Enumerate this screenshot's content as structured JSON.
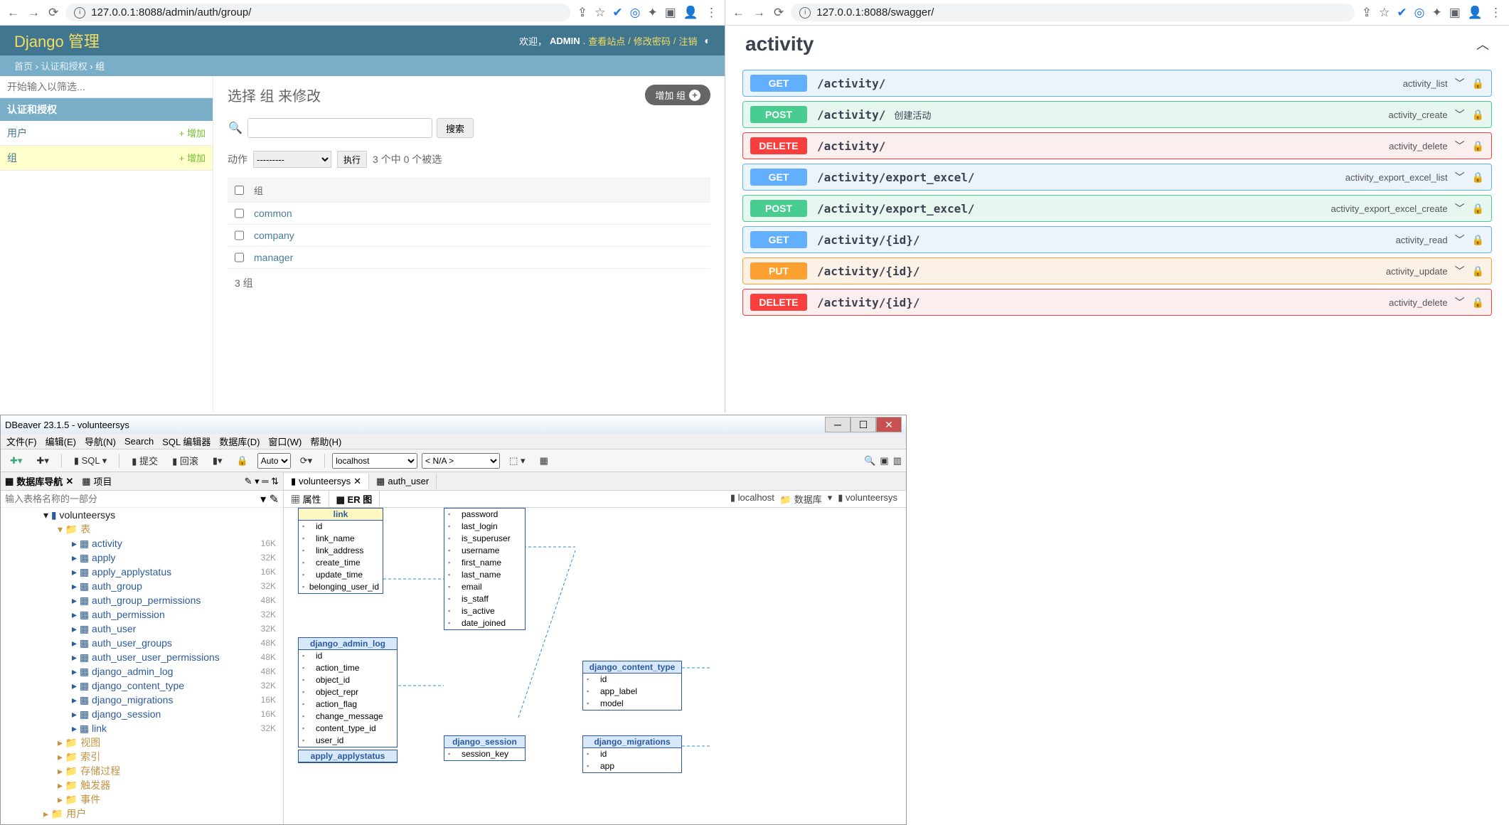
{
  "django": {
    "url": "127.0.0.1:8088/admin/auth/group/",
    "brand": "Django 管理",
    "welcome": "欢迎，",
    "user": "ADMIN",
    "view_site": "查看站点",
    "change_pw": "修改密码",
    "logout": "注销",
    "bc_home": "首页",
    "bc_app": "认证和授权",
    "bc_model": "组",
    "filter_ph": "开始输入以筛选...",
    "app_label": "认证和授权",
    "model_user": "用户",
    "model_group": "组",
    "add_link": "+ 增加",
    "h1": "选择 组 来修改",
    "add_btn": "增加 组",
    "search_btn": "搜索",
    "action_label": "动作",
    "action_default": "---------",
    "go": "执行",
    "sel_text": "3 个中 0 个被选",
    "th_group": "组",
    "rows": [
      "common",
      "company",
      "manager"
    ],
    "count": "3 组"
  },
  "swagger": {
    "url": "127.0.0.1:8088/swagger/",
    "tag": "activity",
    "ops": [
      {
        "verb": "GET",
        "path": "/activity/",
        "summary": "",
        "opid": "activity_list"
      },
      {
        "verb": "POST",
        "path": "/activity/",
        "summary": "创建活动",
        "opid": "activity_create"
      },
      {
        "verb": "DELETE",
        "path": "/activity/",
        "summary": "",
        "opid": "activity_delete"
      },
      {
        "verb": "GET",
        "path": "/activity/export_excel/",
        "summary": "",
        "opid": "activity_export_excel_list"
      },
      {
        "verb": "POST",
        "path": "/activity/export_excel/",
        "summary": "",
        "opid": "activity_export_excel_create"
      },
      {
        "verb": "GET",
        "path": "/activity/{id}/",
        "summary": "",
        "opid": "activity_read"
      },
      {
        "verb": "PUT",
        "path": "/activity/{id}/",
        "summary": "",
        "opid": "activity_update"
      },
      {
        "verb": "DELETE",
        "path": "/activity/{id}/",
        "summary": "",
        "opid": "activity_delete"
      }
    ]
  },
  "dbeaver": {
    "title": "DBeaver 23.1.5 - volunteersys",
    "menu": [
      "文件(F)",
      "编辑(E)",
      "导航(N)",
      "Search",
      "SQL 编辑器",
      "数据库(D)",
      "窗口(W)",
      "帮助(H)"
    ],
    "tool_sql": "SQL",
    "tool_commit": "提交",
    "tool_rollback": "回滚",
    "tool_auto": "Auto",
    "tool_conn": "localhost",
    "tool_db": "< N/A >",
    "nav_tab1": "数据库导航",
    "nav_tab2": "项目",
    "nav_filter_ph": "输入表格名称的一部分",
    "tree_root": "volunteersys",
    "tree_tables": "表",
    "tables": [
      {
        "n": "activity",
        "s": "16K"
      },
      {
        "n": "apply",
        "s": "32K"
      },
      {
        "n": "apply_applystatus",
        "s": "16K"
      },
      {
        "n": "auth_group",
        "s": "32K"
      },
      {
        "n": "auth_group_permissions",
        "s": "48K"
      },
      {
        "n": "auth_permission",
        "s": "32K"
      },
      {
        "n": "auth_user",
        "s": "32K"
      },
      {
        "n": "auth_user_groups",
        "s": "48K"
      },
      {
        "n": "auth_user_user_permissions",
        "s": "48K"
      },
      {
        "n": "django_admin_log",
        "s": "48K"
      },
      {
        "n": "django_content_type",
        "s": "32K"
      },
      {
        "n": "django_migrations",
        "s": "16K"
      },
      {
        "n": "django_session",
        "s": "16K"
      },
      {
        "n": "link",
        "s": "32K"
      }
    ],
    "tree_folders": [
      "视图",
      "索引",
      "存储过程",
      "触发器",
      "事件"
    ],
    "tree_users": "用户",
    "ed_tab1": "volunteersys",
    "ed_tab2": "auth_user",
    "sub_props": "属性",
    "sub_er": "ER 图",
    "crumb_host": "localhost",
    "crumb_db": "数据库",
    "crumb_schema": "volunteersys",
    "er": {
      "link": {
        "hd": "link",
        "cols": [
          "id",
          "link_name",
          "link_address",
          "create_time",
          "update_time",
          "belonging_user_id"
        ]
      },
      "authuser": {
        "cols": [
          "password",
          "last_login",
          "is_superuser",
          "username",
          "first_name",
          "last_name",
          "email",
          "is_staff",
          "is_active",
          "date_joined"
        ]
      },
      "adminlog": {
        "hd": "django_admin_log",
        "cols": [
          "id",
          "action_time",
          "object_id",
          "object_repr",
          "action_flag",
          "change_message",
          "content_type_id",
          "user_id"
        ]
      },
      "ctype": {
        "hd": "django_content_type",
        "cols": [
          "id",
          "app_label",
          "model"
        ]
      },
      "session": {
        "hd": "django_session",
        "cols": [
          "session_key"
        ]
      },
      "migrations": {
        "hd": "django_migrations",
        "cols": [
          "id",
          "app"
        ]
      },
      "applystatus": {
        "hd": "apply_applystatus"
      }
    }
  }
}
